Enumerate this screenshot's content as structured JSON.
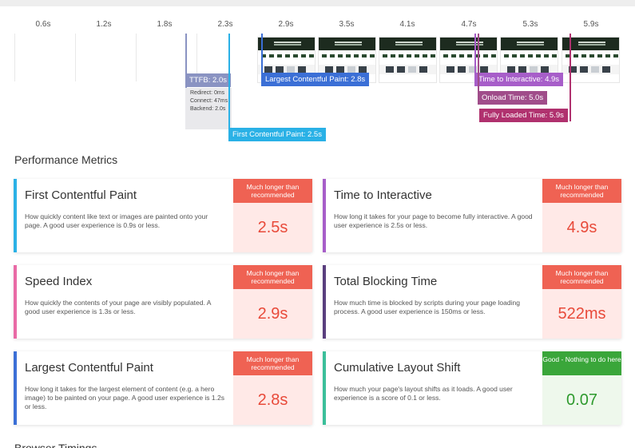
{
  "timeline": {
    "ticks": [
      "0.6s",
      "1.2s",
      "1.8s",
      "2.3s",
      "2.9s",
      "3.5s",
      "4.1s",
      "4.7s",
      "5.3s",
      "5.9s"
    ],
    "markers": {
      "ttfb": "TTFB: 2.0s",
      "ttfb_details": [
        "Redirect: 0ms",
        "Connect: 47ms",
        "Backend: 2.0s"
      ],
      "fcp": "First Contentful Paint: 2.5s",
      "lcp": "Largest Contentful Paint: 2.8s",
      "tti": "Time to Interactive: 4.9s",
      "onload": "Onload Time: 5.0s",
      "fully_loaded": "Fully Loaded Time: 5.9s"
    },
    "colors": {
      "ttfb": "#8a93c2",
      "fcp": "#2ab1e6",
      "lcp": "#3b6fd6",
      "tti": "#a75ec9",
      "onload": "#a04d8a",
      "fully_loaded": "#b0316e"
    }
  },
  "performance": {
    "title": "Performance Metrics",
    "metrics": [
      {
        "name": "First Contentful Paint",
        "desc": "How quickly content like text or images are painted onto your page. A good user experience is 0.9s or less.",
        "badge": "Much longer than recommended",
        "value": "2.5s",
        "status": "bad",
        "accent": "#2ab1e6"
      },
      {
        "name": "Time to Interactive",
        "desc": "How long it takes for your page to become fully interactive. A good user experience is 2.5s or less.",
        "badge": "Much longer than recommended",
        "value": "4.9s",
        "status": "bad",
        "accent": "#a75ec9"
      },
      {
        "name": "Speed Index",
        "desc": "How quickly the contents of your page are visibly populated. A good user experience is 1.3s or less.",
        "badge": "Much longer than recommended",
        "value": "2.9s",
        "status": "bad",
        "accent": "#e96aa6"
      },
      {
        "name": "Total Blocking Time",
        "desc": "How much time is blocked by scripts during your page loading process. A good user experience is 150ms or less.",
        "badge": "Much longer than recommended",
        "value": "522ms",
        "status": "bad",
        "accent": "#5a3f7e"
      },
      {
        "name": "Largest Contentful Paint",
        "desc": "How long it takes for the largest element of content (e.g. a hero image) to be painted on your page. A good user experience is 1.2s or less.",
        "badge": "Much longer than recommended",
        "value": "2.8s",
        "status": "bad",
        "accent": "#3b6fd6"
      },
      {
        "name": "Cumulative Layout Shift",
        "desc": "How much your page's layout shifts as it loads. A good user experience is a score of 0.1 or less.",
        "badge": "Good - Nothing to do here",
        "value": "0.07",
        "status": "good",
        "accent": "#3bbf9a"
      }
    ]
  },
  "next_section": {
    "title": "Browser Timings"
  }
}
